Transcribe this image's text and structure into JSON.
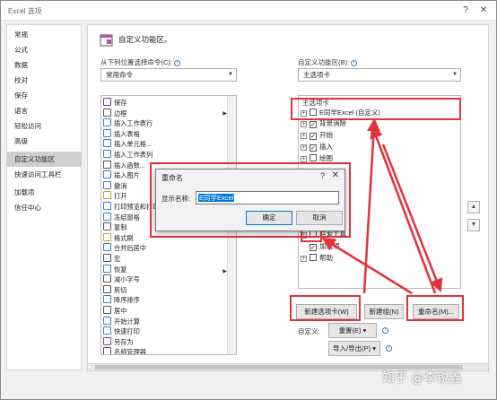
{
  "window": {
    "title": "Excel 选项",
    "help": "?",
    "close": "✕"
  },
  "nav": {
    "items": [
      "常规",
      "公式",
      "数据",
      "校对",
      "保存",
      "语言",
      "轻松访问",
      "高级",
      "自定义功能区",
      "快速访问工具栏",
      "加载项",
      "信任中心"
    ],
    "selected_index": 8
  },
  "main": {
    "title": "自定义功能区。",
    "choose_label": "从下列位置选择命令(C):",
    "choose_value": "常用命令",
    "customize_label": "自定义功能区(B):",
    "customize_value": "主选项卡",
    "commands": [
      "保存",
      "边框",
      "插入工作表行",
      "插入表格",
      "插入单元格...",
      "插入工作表列",
      "插入函数...",
      "插入图片",
      "撤消",
      "打开",
      "打印预览和打印",
      "冻结窗格",
      "复制",
      "格式刷",
      "合并后居中",
      "宏",
      "恢复",
      "减小字号",
      "剪切",
      "降序排序",
      "居中",
      "开始计算",
      "快速打印",
      "另存为",
      "名称管理器"
    ],
    "tree_header": "主选项卡",
    "tree": [
      {
        "label": "E同学Excel (自定义)",
        "checked": false,
        "expand": "⊞"
      },
      {
        "label": "背景消除",
        "checked": true,
        "expand": "⊞"
      },
      {
        "label": "开始",
        "checked": true,
        "expand": "⊞"
      },
      {
        "label": "插入",
        "checked": true,
        "expand": "⊞"
      },
      {
        "label": "绘图",
        "checked": false,
        "expand": "⊞"
      },
      {
        "label": "开发工具",
        "checked": false,
        "expand": "⊞"
      },
      {
        "label": "加载项",
        "checked": true,
        "expand": ""
      },
      {
        "label": "帮助",
        "checked": false,
        "expand": "⊞"
      }
    ],
    "new_tab_button": "新建选项卡(W)",
    "new_group_button": "新建组(N)",
    "rename_button": "重命名(M)...",
    "customize_text": "自定义:",
    "reset_button": "重置(E) ▾",
    "import_export_button": "导入/导出(P) ▾",
    "move_up": "▲",
    "move_down": "▼"
  },
  "dialog": {
    "title": "重命名",
    "help": "?",
    "close": "✕",
    "display_name_label": "显示名称:",
    "display_name_value": "E同学Excel",
    "ok": "确定",
    "cancel": "取消"
  },
  "watermark": "知乎 @李锐鑫",
  "colors": {
    "highlight": "#e3323b",
    "selection": "#0078d7"
  }
}
